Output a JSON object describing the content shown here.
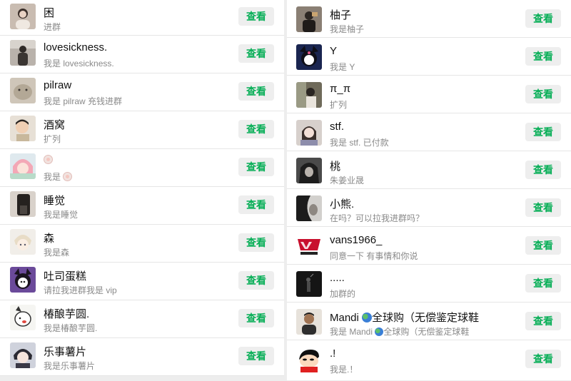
{
  "view_label": "查看",
  "left": [
    {
      "name": "困",
      "sub": "进群",
      "avatar": "avatar-girl-photo"
    },
    {
      "name": "lovesickness.",
      "sub": "我是 lovesickness.",
      "avatar": "avatar-person-photo"
    },
    {
      "name": "pilraw",
      "sub": "我是 pilraw 充钱进群",
      "avatar": "avatar-plush-photo"
    },
    {
      "name": "酒窝",
      "sub": "扩列",
      "avatar": "avatar-boy-photo"
    },
    {
      "name_prefix": "",
      "sub_prefix": "我是 ",
      "avatar": "avatar-anime-girl"
    },
    {
      "name": "睡觉",
      "sub": "我是睡觉",
      "avatar": "avatar-dark-photo"
    },
    {
      "name": "森",
      "sub": "我是森",
      "avatar": "avatar-anime-boy"
    },
    {
      "name": "吐司蛋糕",
      "sub": "请拉我进群我是 vip",
      "avatar": "avatar-kuromi"
    },
    {
      "name": "椿酿芋圆.",
      "sub": "我是椿酿芋圆.",
      "avatar": "avatar-cartoon-dog"
    },
    {
      "name": "乐事薯片",
      "sub": "我是乐事薯片",
      "avatar": "avatar-anime-dark"
    }
  ],
  "right": [
    {
      "name": "柚子",
      "sub": "我是柚子",
      "avatar": "avatar-person-dark"
    },
    {
      "name": "Y",
      "sub": "我是 Y",
      "avatar": "avatar-kuromi-blue"
    },
    {
      "name": "π_π",
      "sub": "扩列",
      "avatar": "avatar-girl-mirror"
    },
    {
      "name": "stf.",
      "sub": "我是 stf. 已付款",
      "avatar": "avatar-girl-light"
    },
    {
      "name": "桃",
      "sub": "朱姜业晟",
      "avatar": "avatar-hood-dark"
    },
    {
      "name": "小熊.",
      "sub": "在吗？可以拉我进群吗？",
      "avatar": "avatar-shadow-face"
    },
    {
      "name": "vans1966_",
      "sub": "同意一下 有事情和你说",
      "avatar": "avatar-vans-logo"
    },
    {
      "name": ".....",
      "sub": "加群的",
      "avatar": "avatar-dark-figure"
    },
    {
      "name_prefix": "Mandi ",
      "name_suffix": "全球购（无偿鉴定球鞋",
      "sub_prefix": "我是 Mandi ",
      "sub_suffix": "全球购（无偿鉴定球鞋",
      "avatar": "avatar-man-photo"
    },
    {
      "name": ".!",
      "sub": "我是.！",
      "avatar": "avatar-shinchan"
    }
  ]
}
